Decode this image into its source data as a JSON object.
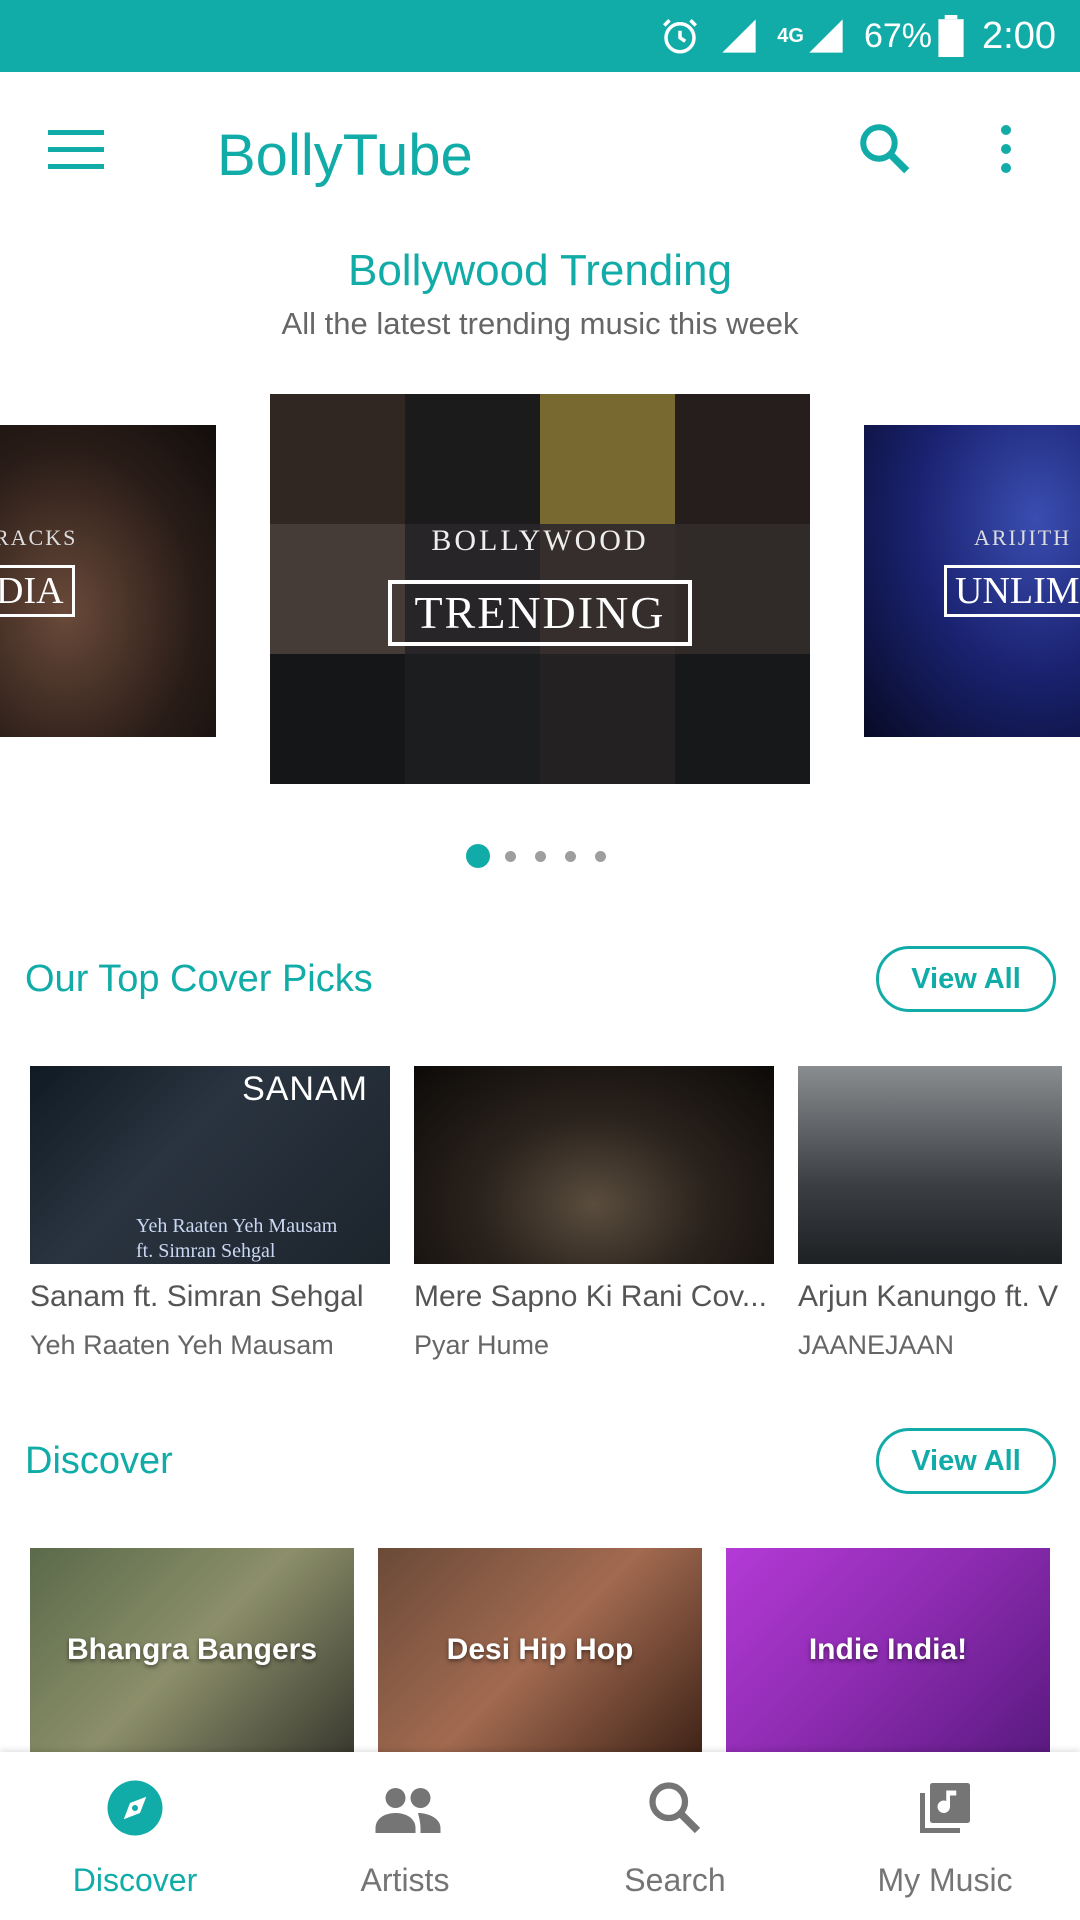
{
  "status_bar": {
    "network": "4G",
    "battery": "67%",
    "time": "2:00"
  },
  "app_bar": {
    "title": "BollyTube",
    "icons": [
      "menu-icon",
      "search-icon",
      "more-vert-icon"
    ]
  },
  "trending": {
    "title": "Bollywood Trending",
    "subtitle": "All the latest trending music this week",
    "slides": [
      {
        "top": "RACKS",
        "big": "DIA"
      },
      {
        "top": "BOLLYWOOD",
        "big": "TRENDING"
      },
      {
        "top": "ARIJITH",
        "big": "UNLIM"
      }
    ],
    "page_count": 5,
    "active_page": 1
  },
  "cover_picks": {
    "title": "Our Top Cover Picks",
    "view_all": "View All",
    "items": [
      {
        "title": "Sanam ft. Simran Sehgal",
        "subtitle": "Yeh Raaten Yeh Mausam",
        "logo": "SANAM",
        "caption_1": "Yeh Raaten Yeh Mausam",
        "caption_2": "ft. Simran Sehgal"
      },
      {
        "title": "Mere Sapno Ki Rani Cov...",
        "subtitle": "Pyar Hume"
      },
      {
        "title": "Arjun Kanungo ft. V",
        "subtitle": "JAANEJAAN"
      }
    ]
  },
  "discover": {
    "title": "Discover",
    "view_all": "View All",
    "items": [
      {
        "label": "Bhangra Bangers"
      },
      {
        "label": "Desi Hip Hop"
      },
      {
        "label": "Indie India!"
      }
    ]
  },
  "bottom_nav": {
    "items": [
      {
        "label": "Discover",
        "icon": "compass-icon",
        "active": true
      },
      {
        "label": "Artists",
        "icon": "people-icon",
        "active": false
      },
      {
        "label": "Search",
        "icon": "search-icon",
        "active": false
      },
      {
        "label": "My Music",
        "icon": "music-library-icon",
        "active": false
      }
    ]
  },
  "colors": {
    "accent": "#12aca8",
    "inactive": "#757575"
  }
}
